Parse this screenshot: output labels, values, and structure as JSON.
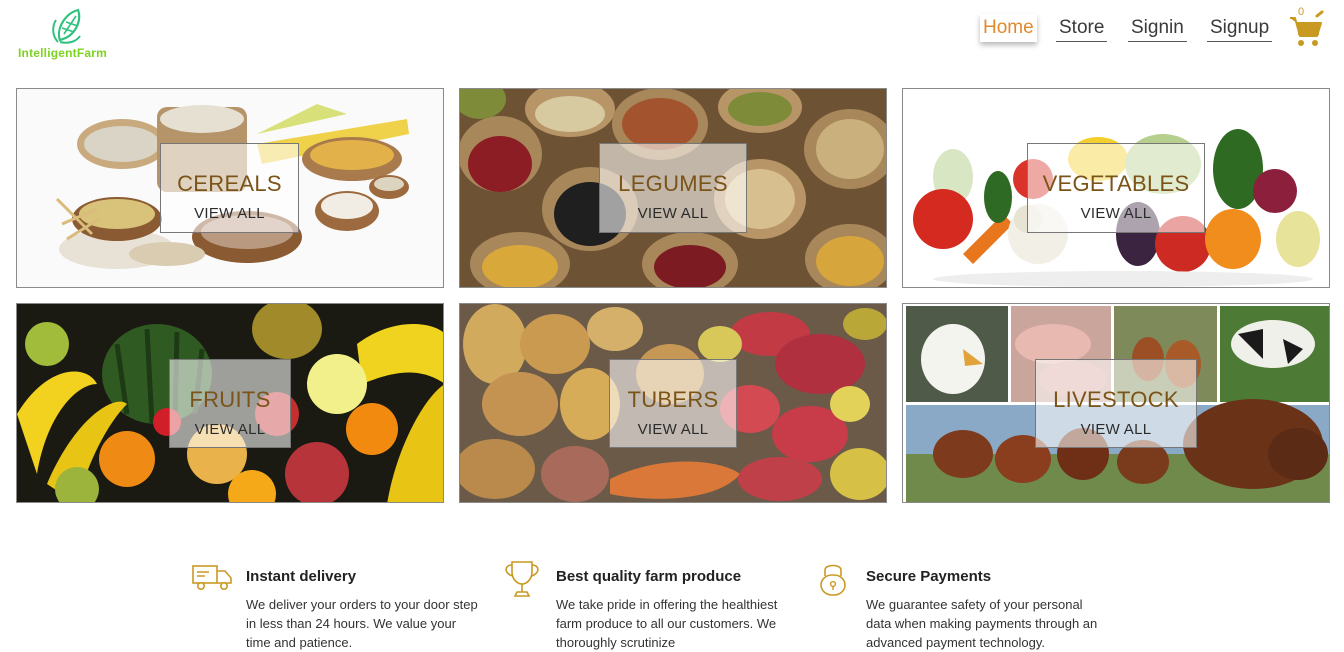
{
  "brand": {
    "name": "IntelligentFarm"
  },
  "nav": {
    "items": [
      "Home",
      "Store",
      "Signin",
      "Signup"
    ],
    "active": "Home",
    "cart_count": "0"
  },
  "categories": [
    {
      "title": "CEREALS",
      "link": "VIEW ALL"
    },
    {
      "title": "LEGUMES",
      "link": "VIEW ALL"
    },
    {
      "title": "VEGETABLES",
      "link": "VIEW ALL"
    },
    {
      "title": "FRUITS",
      "link": "VIEW ALL"
    },
    {
      "title": "TUBERS",
      "link": "VIEW ALL"
    },
    {
      "title": "LIVESTOCK",
      "link": "VIEW ALL"
    }
  ],
  "features": [
    {
      "title": "Instant delivery",
      "text": "We deliver your orders to your door step in less than 24 hours. We value your time and patience."
    },
    {
      "title": "Best quality farm produce",
      "text": "We take pride in offering the healthiest farm produce to all our customers. We thoroughly scrutinize"
    },
    {
      "title": "Secure Payments",
      "text": "We guarantee safety of your personal data when making payments through an advanced payment technology."
    }
  ],
  "colors": {
    "accent": "#e08a2c",
    "brand": "#7dd321",
    "icon": "#c99a22"
  }
}
